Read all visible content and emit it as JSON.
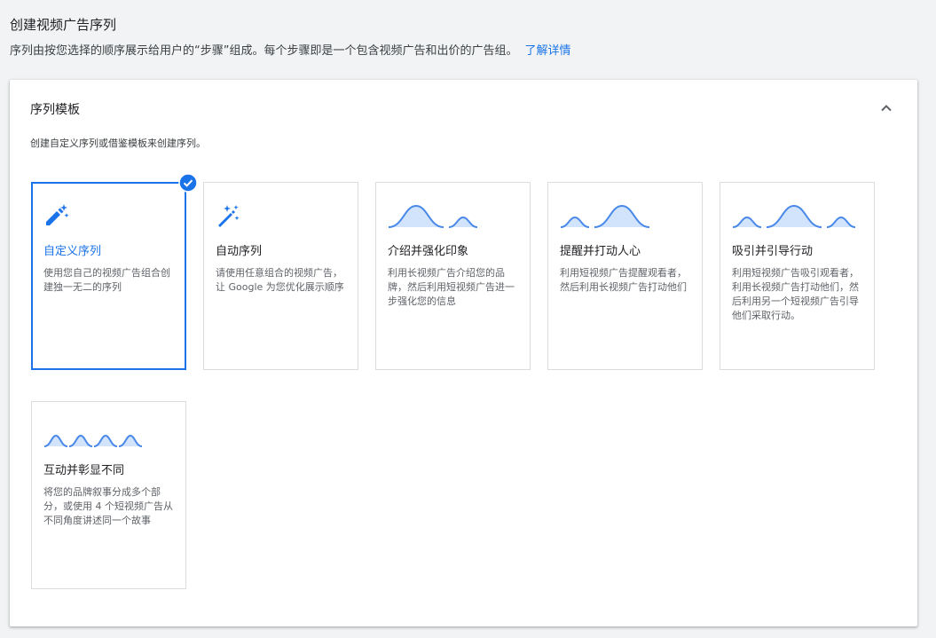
{
  "header": {
    "title": "创建视频广告序列",
    "description": "序列由按您选择的顺序展示给用户的“步骤”组成。每个步骤即是一个包含视频广告和出价的广告组。",
    "learn_more": "了解详情"
  },
  "panel": {
    "title": "序列模板",
    "hint": "创建自定义序列或借鉴模板来创建序列。",
    "collapse_icon": "chevron-up-icon"
  },
  "templates": [
    {
      "title": "自定义序列",
      "desc": "使用您自己的视频广告组合创建独一无二的序列",
      "icon": "edit-sparkle-icon",
      "selected": true
    },
    {
      "title": "自动序列",
      "desc": "请使用任意组合的视频广告，让 Google 为您优化展示顺序",
      "icon": "magic-wand-icon",
      "selected": false
    },
    {
      "title": "介绍并强化印象",
      "desc": "利用长视频广告介绍您的品牌，然后利用短视频广告进一步强化您的信息",
      "icon": "long-short-wave-icon",
      "selected": false
    },
    {
      "title": "提醒并打动人心",
      "desc": "利用短视频广告提醒观看者，然后利用长视频广告打动他们",
      "icon": "short-long-wave-icon",
      "selected": false
    },
    {
      "title": "吸引并引导行动",
      "desc": "利用短视频广告吸引观看者，利用长视频广告打动他们，然后利用另一个短视频广告引导他们采取行动。",
      "icon": "short-long-short-wave-icon",
      "selected": false
    },
    {
      "title": "互动并彰显不同",
      "desc": "将您的品牌叙事分成多个部分，或使用 4 个短视频广告从不同角度讲述同一个故事",
      "icon": "four-short-waves-icon",
      "selected": false
    }
  ],
  "colors": {
    "accent": "#1a73e8",
    "wave_fill": "#d2e3fc",
    "wave_stroke": "#4a89e8"
  }
}
